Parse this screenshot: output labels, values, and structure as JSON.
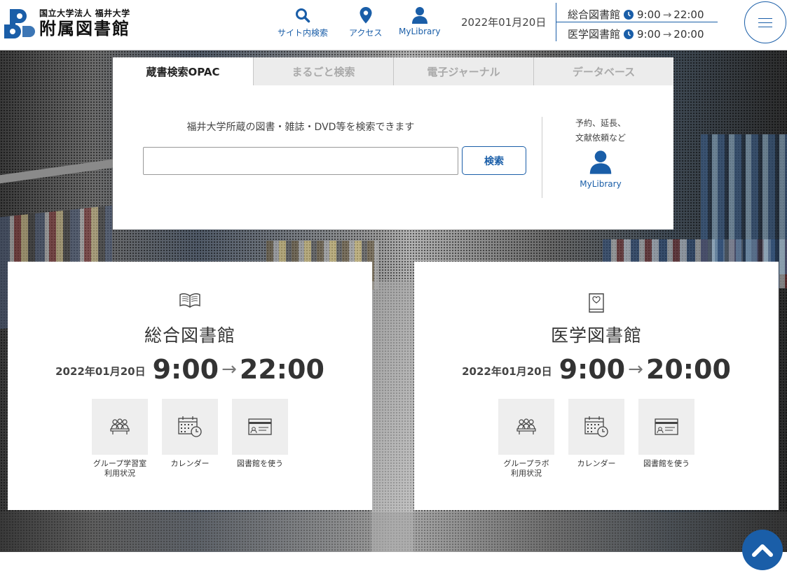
{
  "header": {
    "logo_sub": "国立大学法人 福井大学",
    "logo_main": "附属図書館",
    "nav": [
      {
        "label": "サイト内検索",
        "icon": "search-icon"
      },
      {
        "label": "アクセス",
        "icon": "map-pin-icon"
      },
      {
        "label": "MyLibrary",
        "icon": "user-icon"
      }
    ],
    "date": "2022年01月20日",
    "hours": [
      {
        "library": "総合図書館",
        "open": "9:00",
        "arrow": "→",
        "close": "22:00"
      },
      {
        "library": "医学図書館",
        "open": "9:00",
        "arrow": "→",
        "close": "20:00"
      }
    ],
    "menu_icon": "hamburger-icon"
  },
  "search": {
    "tabs": [
      {
        "label": "蔵書検索OPAC",
        "active": true
      },
      {
        "label": "まるごと検索",
        "active": false
      },
      {
        "label": "電子ジャーナル",
        "active": false
      },
      {
        "label": "データベース",
        "active": false
      }
    ],
    "caption": "福井大学所蔵の図書・雑誌・DVD等を検索できます",
    "input_value": "",
    "button_label": "検索",
    "side_note_1": "予約、延長、",
    "side_note_2": "文献依頼など",
    "side_link": "MyLibrary"
  },
  "libraries": [
    {
      "name": "総合図書館",
      "icon": "open-book-icon",
      "date": "2022年01月20日",
      "open": "9:00",
      "arrow": "→",
      "close": "22:00",
      "tiles": [
        {
          "label1": "グループ学習室",
          "label2": "利用状況",
          "icon": "group-icon"
        },
        {
          "label1": "カレンダー",
          "label2": "",
          "icon": "calendar-clock-icon"
        },
        {
          "label1": "図書館を使う",
          "label2": "",
          "icon": "library-card-icon"
        }
      ]
    },
    {
      "name": "医学図書館",
      "icon": "heart-book-icon",
      "date": "2022年01月20日",
      "open": "9:00",
      "arrow": "→",
      "close": "20:00",
      "tiles": [
        {
          "label1": "グループラボ",
          "label2": "利用状況",
          "icon": "group-icon"
        },
        {
          "label1": "カレンダー",
          "label2": "",
          "icon": "calendar-clock-icon"
        },
        {
          "label1": "図書館を使う",
          "label2": "",
          "icon": "library-card-icon"
        }
      ]
    }
  ],
  "colors": {
    "accent": "#1a5ea8",
    "tile_bg": "#eeeeee",
    "tab_inactive": "#ececec"
  },
  "to_top_icon": "chevron-up-icon"
}
